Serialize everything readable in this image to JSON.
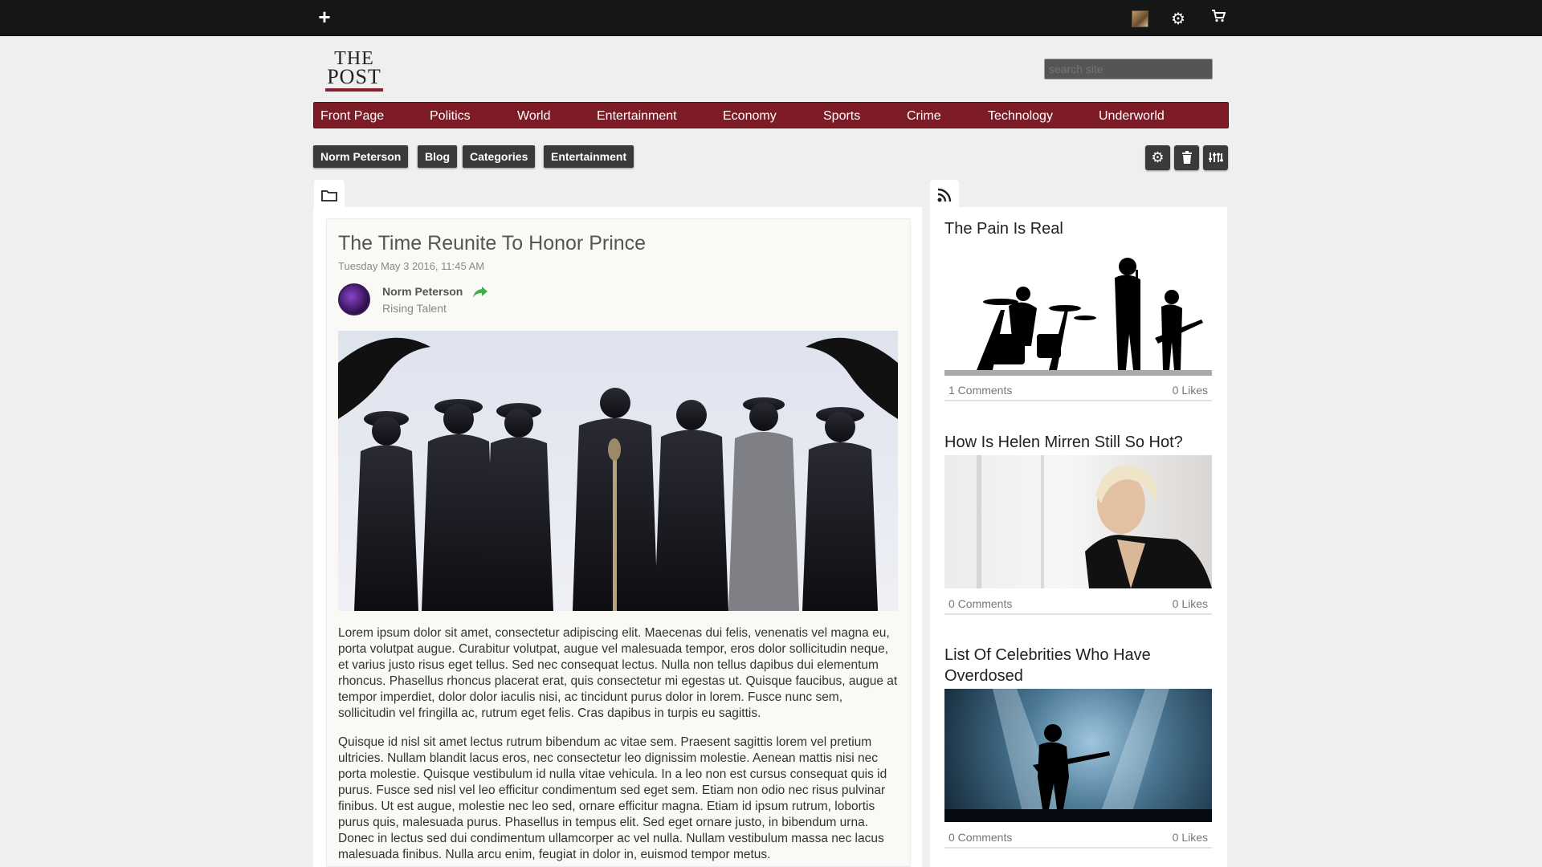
{
  "topbar": {
    "add_icon": "plus-icon",
    "settings_icon": "gear-icon",
    "cart_icon": "cart-icon"
  },
  "header": {
    "logo_line1": "THE",
    "logo_line2": "POST",
    "search_placeholder": "search site",
    "brand_color": "#7d1b26"
  },
  "nav": [
    "Front Page",
    "Politics",
    "World",
    "Entertainment",
    "Economy",
    "Sports",
    "Crime",
    "Technology",
    "Underworld"
  ],
  "breadcrumb": [
    "Norm Peterson",
    "Blog",
    "Categories",
    "Entertainment"
  ],
  "toolbar": {
    "icons": [
      "gear-icon",
      "trash-icon",
      "sort-icon"
    ]
  },
  "article": {
    "title": "The Time Reunite To Honor Prince",
    "date": "Tuesday May 3 2016, 11:45 AM",
    "author": "Norm Peterson",
    "author_role": "Rising Talent",
    "paragraphs": [
      "Lorem ipsum dolor sit amet, consectetur adipiscing elit. Maecenas dui felis, venenatis vel magna eu, porta volutpat augue. Curabitur volutpat, augue vel malesuada tempor, eros dolor sollicitudin neque, et varius justo risus eget tellus. Sed nec consequat lectus. Nulla non tellus dapibus dui elementum rhoncus. Phasellus rhoncus placerat erat, quis consectetur mi egestas ut. Quisque faucibus, augue at tempor imperdiet, dolor dolor iaculis nisi, ac tincidunt purus dolor in lorem. Fusce nunc sem, sollicitudin vel fringilla ac, rutrum eget felis. Cras dapibus in turpis eu sagittis.",
      "Quisque id nisl sit amet lectus rutrum bibendum ac vitae sem. Praesent sagittis lorem vel pretium ultricies. Nullam blandit lacus eros, nec consectetur leo dignissim molestie. Aenean mattis nisi nec porta molestie. Quisque vestibulum id nulla vitae vehicula. In a leo non est cursus consequat quis id purus. Fusce sed nisl vel leo efficitur condimentum sed eget sem. Etiam non odio nec risus pulvinar finibus. Ut est augue, molestie nec leo sed, ornare efficitur magna. Etiam id ipsum rutrum, lobortis purus quis, malesuada purus. Phasellus in tempus elit. Sed eget ornare justo, in bibendum urna. Donec in lectus sed dui condimentum ullamcorper ac vel nulla. Nullam vestibulum massa nec lacus malesuada finibus. Nulla arcu enim, feugiat in dolor in, euismod tempor metus."
    ]
  },
  "sidebar": {
    "items": [
      {
        "title": "The Pain Is Real",
        "comments": "1 Comments",
        "likes": "0 Likes"
      },
      {
        "title": "How Is Helen Mirren Still So Hot?",
        "comments": "0 Comments",
        "likes": "0 Likes"
      },
      {
        "title": "List Of Celebrities Who Have Overdosed",
        "comments": "0 Comments",
        "likes": "0 Likes"
      }
    ]
  }
}
